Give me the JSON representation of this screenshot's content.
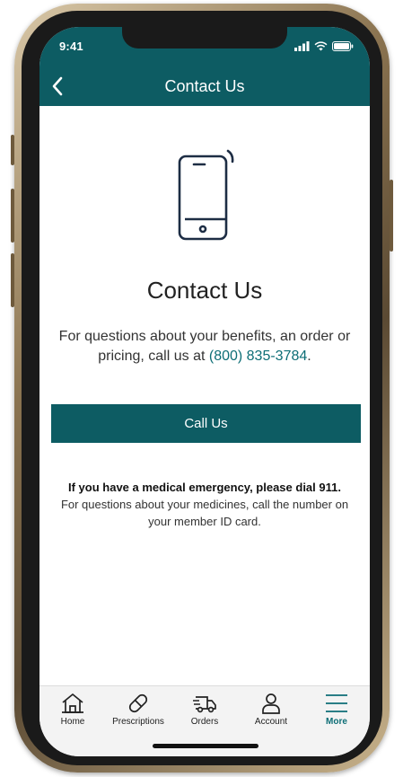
{
  "status_bar": {
    "time": "9:41"
  },
  "nav": {
    "title": "Contact Us",
    "back_icon": "chevron-left-icon"
  },
  "content": {
    "hero_icon": "smartphone-ringing-icon",
    "heading": "Contact Us",
    "intro_text": "For questions about your benefits, an order or pricing, call us at ",
    "phone_number": "(800) 835-3784",
    "intro_end": ".",
    "call_button_label": "Call Us",
    "emergency_bold": "If you have a medical emergency, please dial 911.",
    "emergency_text": "For questions about your medicines, call the number on your member ID card."
  },
  "tabbar": {
    "items": [
      {
        "label": "Home",
        "icon": "home-icon"
      },
      {
        "label": "Prescriptions",
        "icon": "pill-icon"
      },
      {
        "label": "Orders",
        "icon": "delivery-truck-icon"
      },
      {
        "label": "Account",
        "icon": "person-icon"
      },
      {
        "label": "More",
        "icon": "menu-icon",
        "active": true
      }
    ]
  },
  "colors": {
    "primary": "#0d5c63",
    "link": "#0d6e76",
    "frame": "#8a7350"
  }
}
